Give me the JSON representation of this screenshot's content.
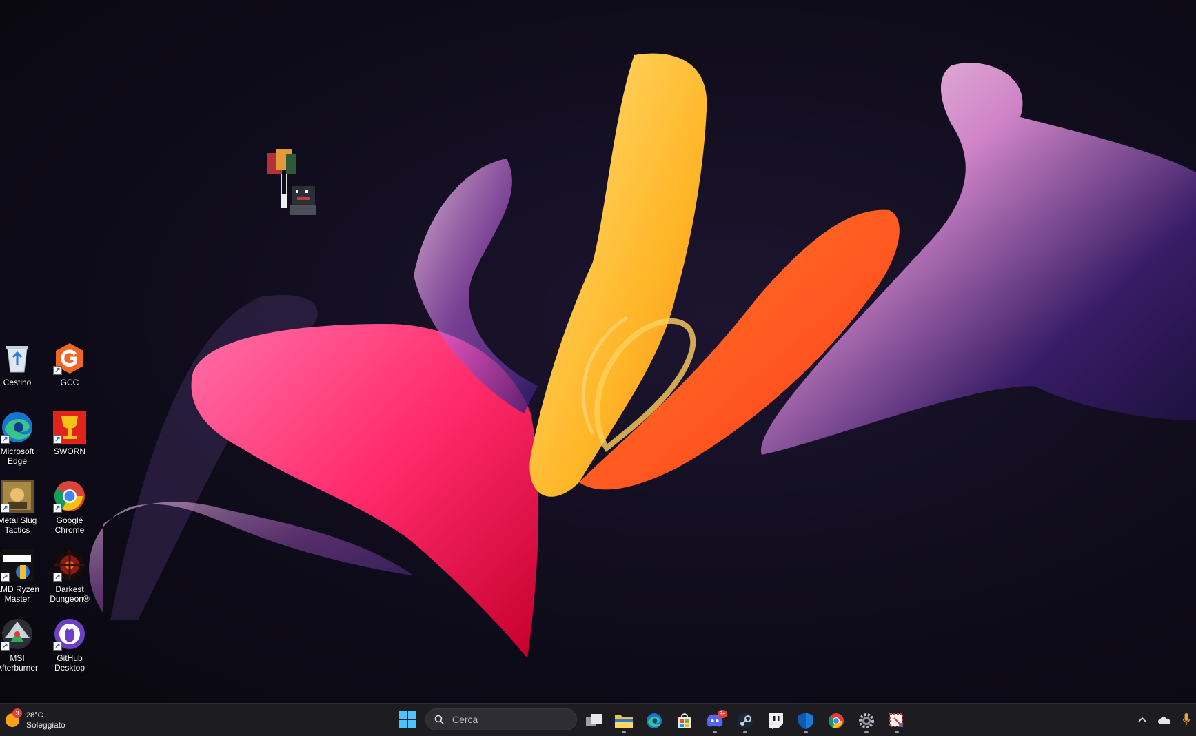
{
  "desktop": {
    "icons": [
      {
        "label": "Cestino",
        "icon": "recycle-bin-icon"
      },
      {
        "label": "GCC",
        "icon": "gcc-icon"
      },
      {
        "label": "Microsoft\nEdge",
        "icon": "edge-icon"
      },
      {
        "label": "SWORN",
        "icon": "sworn-icon"
      },
      {
        "label": "Metal Slug\nTactics",
        "icon": "metal-slug-icon"
      },
      {
        "label": "Google\nChrome",
        "icon": "chrome-icon"
      },
      {
        "label": "AMD Ryzen\nMaster",
        "icon": "ryzen-master-icon"
      },
      {
        "label": "Darkest\nDungeon®",
        "icon": "darkest-dungeon-icon"
      },
      {
        "label": "MSI\nAfterburner",
        "icon": "msi-afterburner-icon"
      },
      {
        "label": "GitHub\nDesktop",
        "icon": "github-desktop-icon"
      }
    ]
  },
  "taskbar": {
    "weather": {
      "temp": "28°C",
      "condition": "Soleggiato",
      "badge": "3"
    },
    "search": {
      "placeholder": "Cerca"
    },
    "apps": [
      {
        "name": "task-view",
        "icon": "task-view-icon"
      },
      {
        "name": "file-explorer",
        "icon": "folder-icon"
      },
      {
        "name": "edge",
        "icon": "edge-icon"
      },
      {
        "name": "store",
        "icon": "store-icon"
      },
      {
        "name": "discord",
        "icon": "discord-icon",
        "badge": "9+"
      },
      {
        "name": "steam",
        "icon": "steam-icon"
      },
      {
        "name": "twitch",
        "icon": "twitch-icon"
      },
      {
        "name": "security",
        "icon": "shield-icon"
      },
      {
        "name": "chrome",
        "icon": "chrome-icon"
      },
      {
        "name": "settings",
        "icon": "gear-icon"
      },
      {
        "name": "snipping-tool",
        "icon": "snipping-tool-icon"
      }
    ],
    "tray": [
      "chevron-up-icon",
      "onedrive-icon",
      "microphone-icon"
    ]
  },
  "colors": {
    "accent": "#4cc2ff",
    "taskbar": "#1c1c21",
    "wallpaper_bg": "#0f0c1b"
  }
}
